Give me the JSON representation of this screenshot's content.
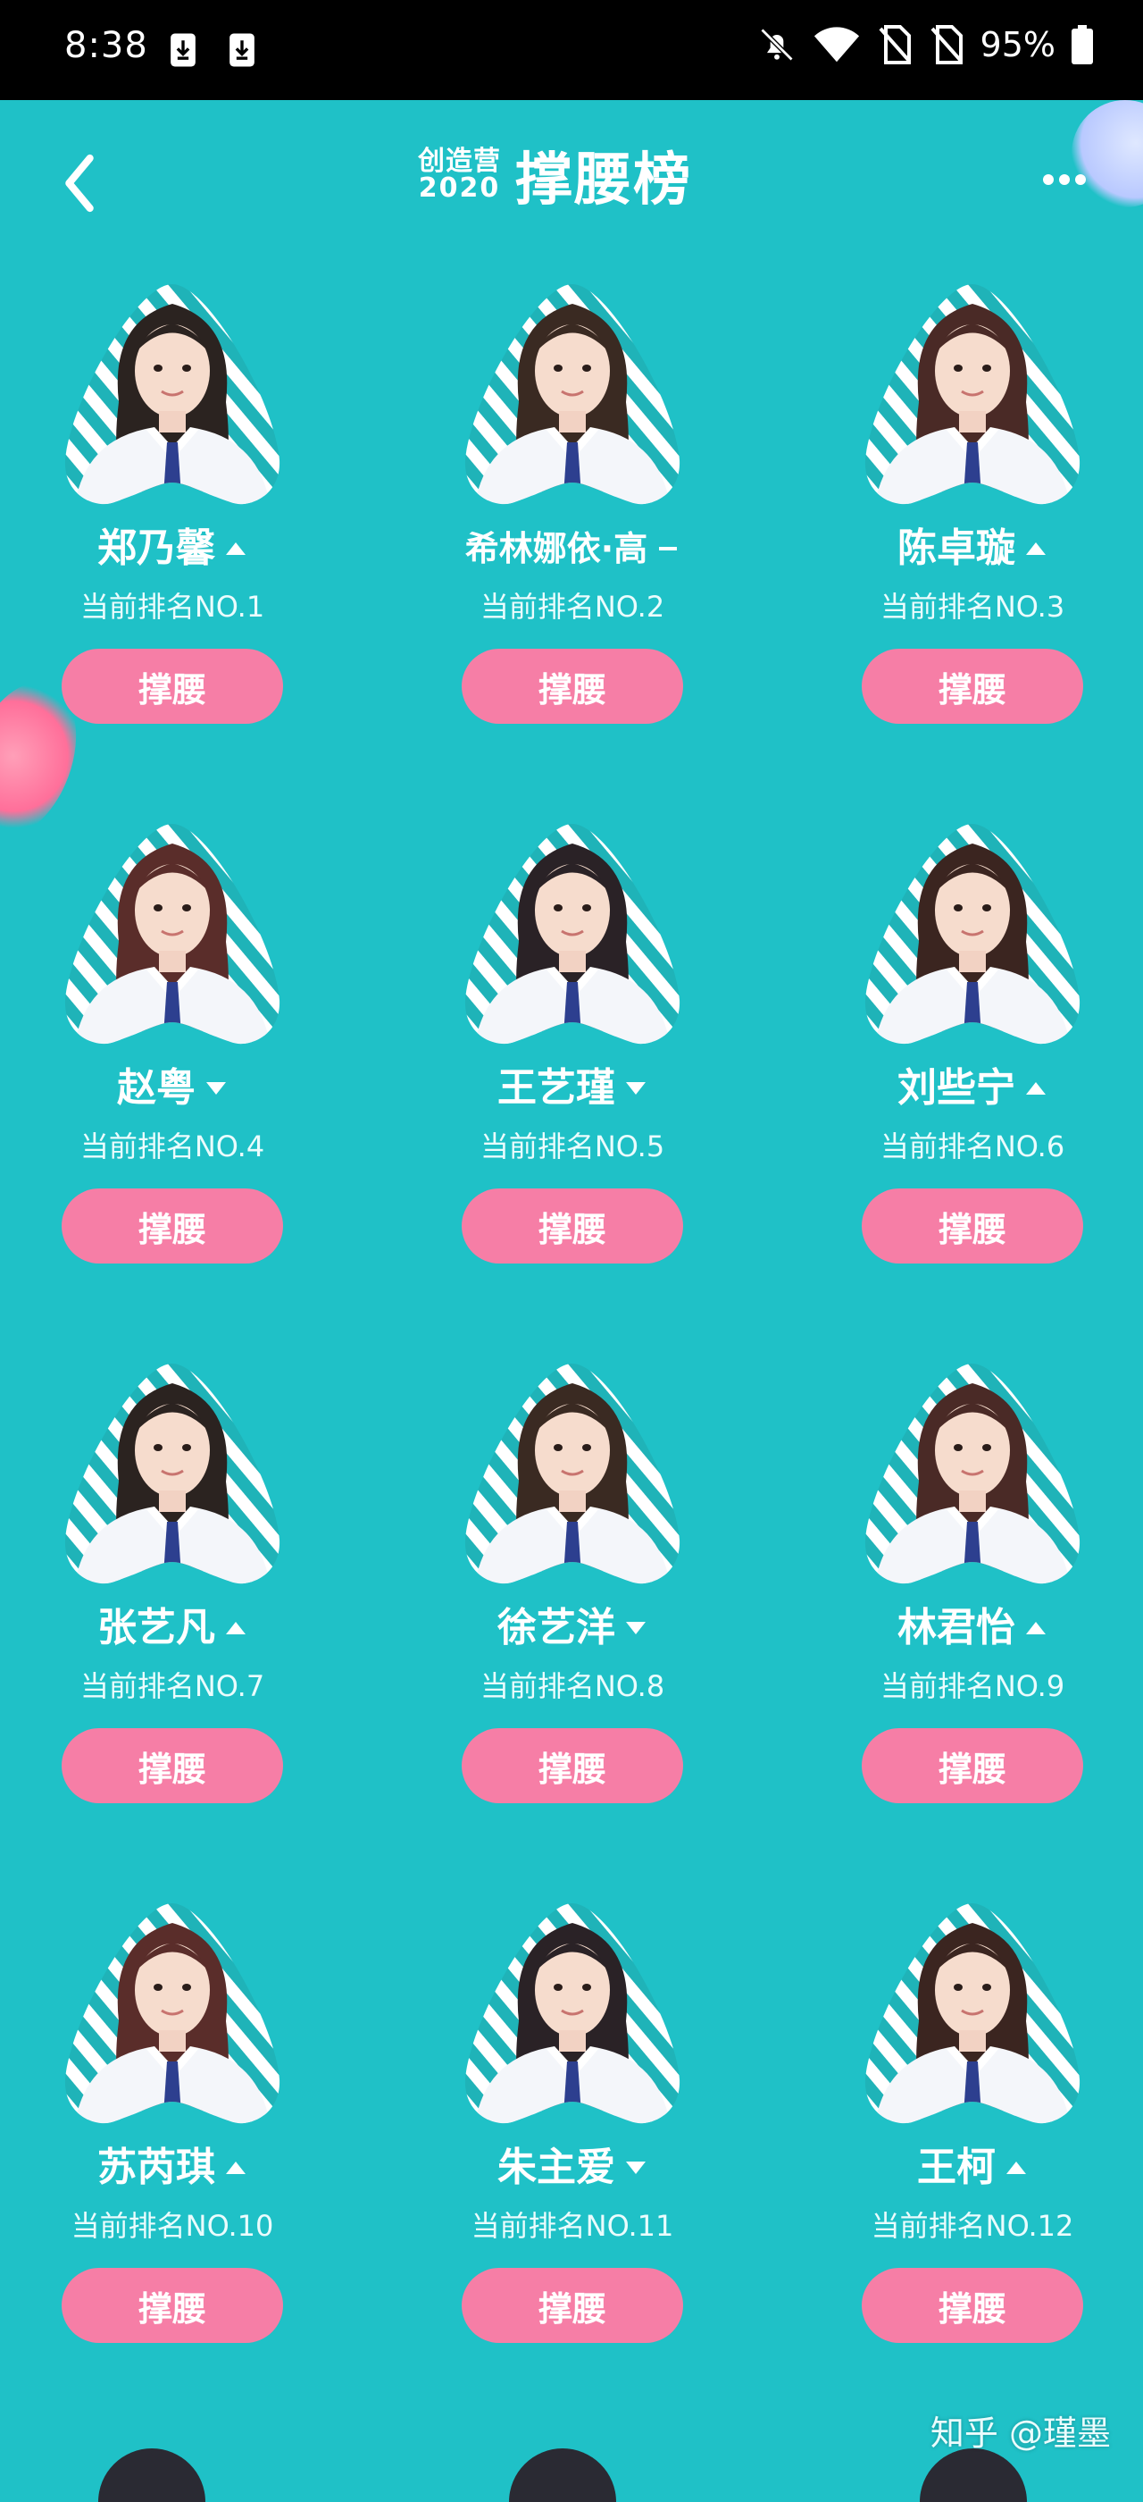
{
  "status_bar": {
    "time": "8:38",
    "battery_percent": "95%",
    "icons": [
      "download-icon",
      "download-icon",
      "bell-off-icon",
      "wifi-icon",
      "no-sim-icon",
      "no-sim-icon",
      "battery-icon"
    ]
  },
  "header": {
    "logo_line1": "创造营",
    "logo_line2": "2020",
    "title": "撑腰榜",
    "back_icon": "chevron-left-icon",
    "more_icon": "more-dots-icon"
  },
  "contestants": [
    {
      "name": "郑乃馨",
      "trend": "up",
      "rank": "当前排名NO.1",
      "button": "撑腰"
    },
    {
      "name": "希林娜依·高",
      "trend": "same",
      "rank": "当前排名NO.2",
      "button": "撑腰"
    },
    {
      "name": "陈卓璇",
      "trend": "up",
      "rank": "当前排名NO.3",
      "button": "撑腰"
    },
    {
      "name": "赵粤",
      "trend": "down",
      "rank": "当前排名NO.4",
      "button": "撑腰"
    },
    {
      "name": "王艺瑾",
      "trend": "down",
      "rank": "当前排名NO.5",
      "button": "撑腰"
    },
    {
      "name": "刘些宁",
      "trend": "up",
      "rank": "当前排名NO.6",
      "button": "撑腰"
    },
    {
      "name": "张艺凡",
      "trend": "up",
      "rank": "当前排名NO.7",
      "button": "撑腰"
    },
    {
      "name": "徐艺洋",
      "trend": "down",
      "rank": "当前排名NO.8",
      "button": "撑腰"
    },
    {
      "name": "林君怡",
      "trend": "up",
      "rank": "当前排名NO.9",
      "button": "撑腰"
    },
    {
      "name": "苏芮琪",
      "trend": "up",
      "rank": "当前排名NO.10",
      "button": "撑腰"
    },
    {
      "name": "朱主爱",
      "trend": "down",
      "rank": "当前排名NO.11",
      "button": "撑腰"
    },
    {
      "name": "王柯",
      "trend": "up",
      "rank": "当前排名NO.12",
      "button": "撑腰"
    }
  ],
  "watermark": "知乎 @瑾墨",
  "colors": {
    "background": "#1fc1c7",
    "button": "#f67ea6",
    "stripe": "#1fb3b8",
    "uniform": "#f4f6fa",
    "tie": "#2d3f8f"
  }
}
